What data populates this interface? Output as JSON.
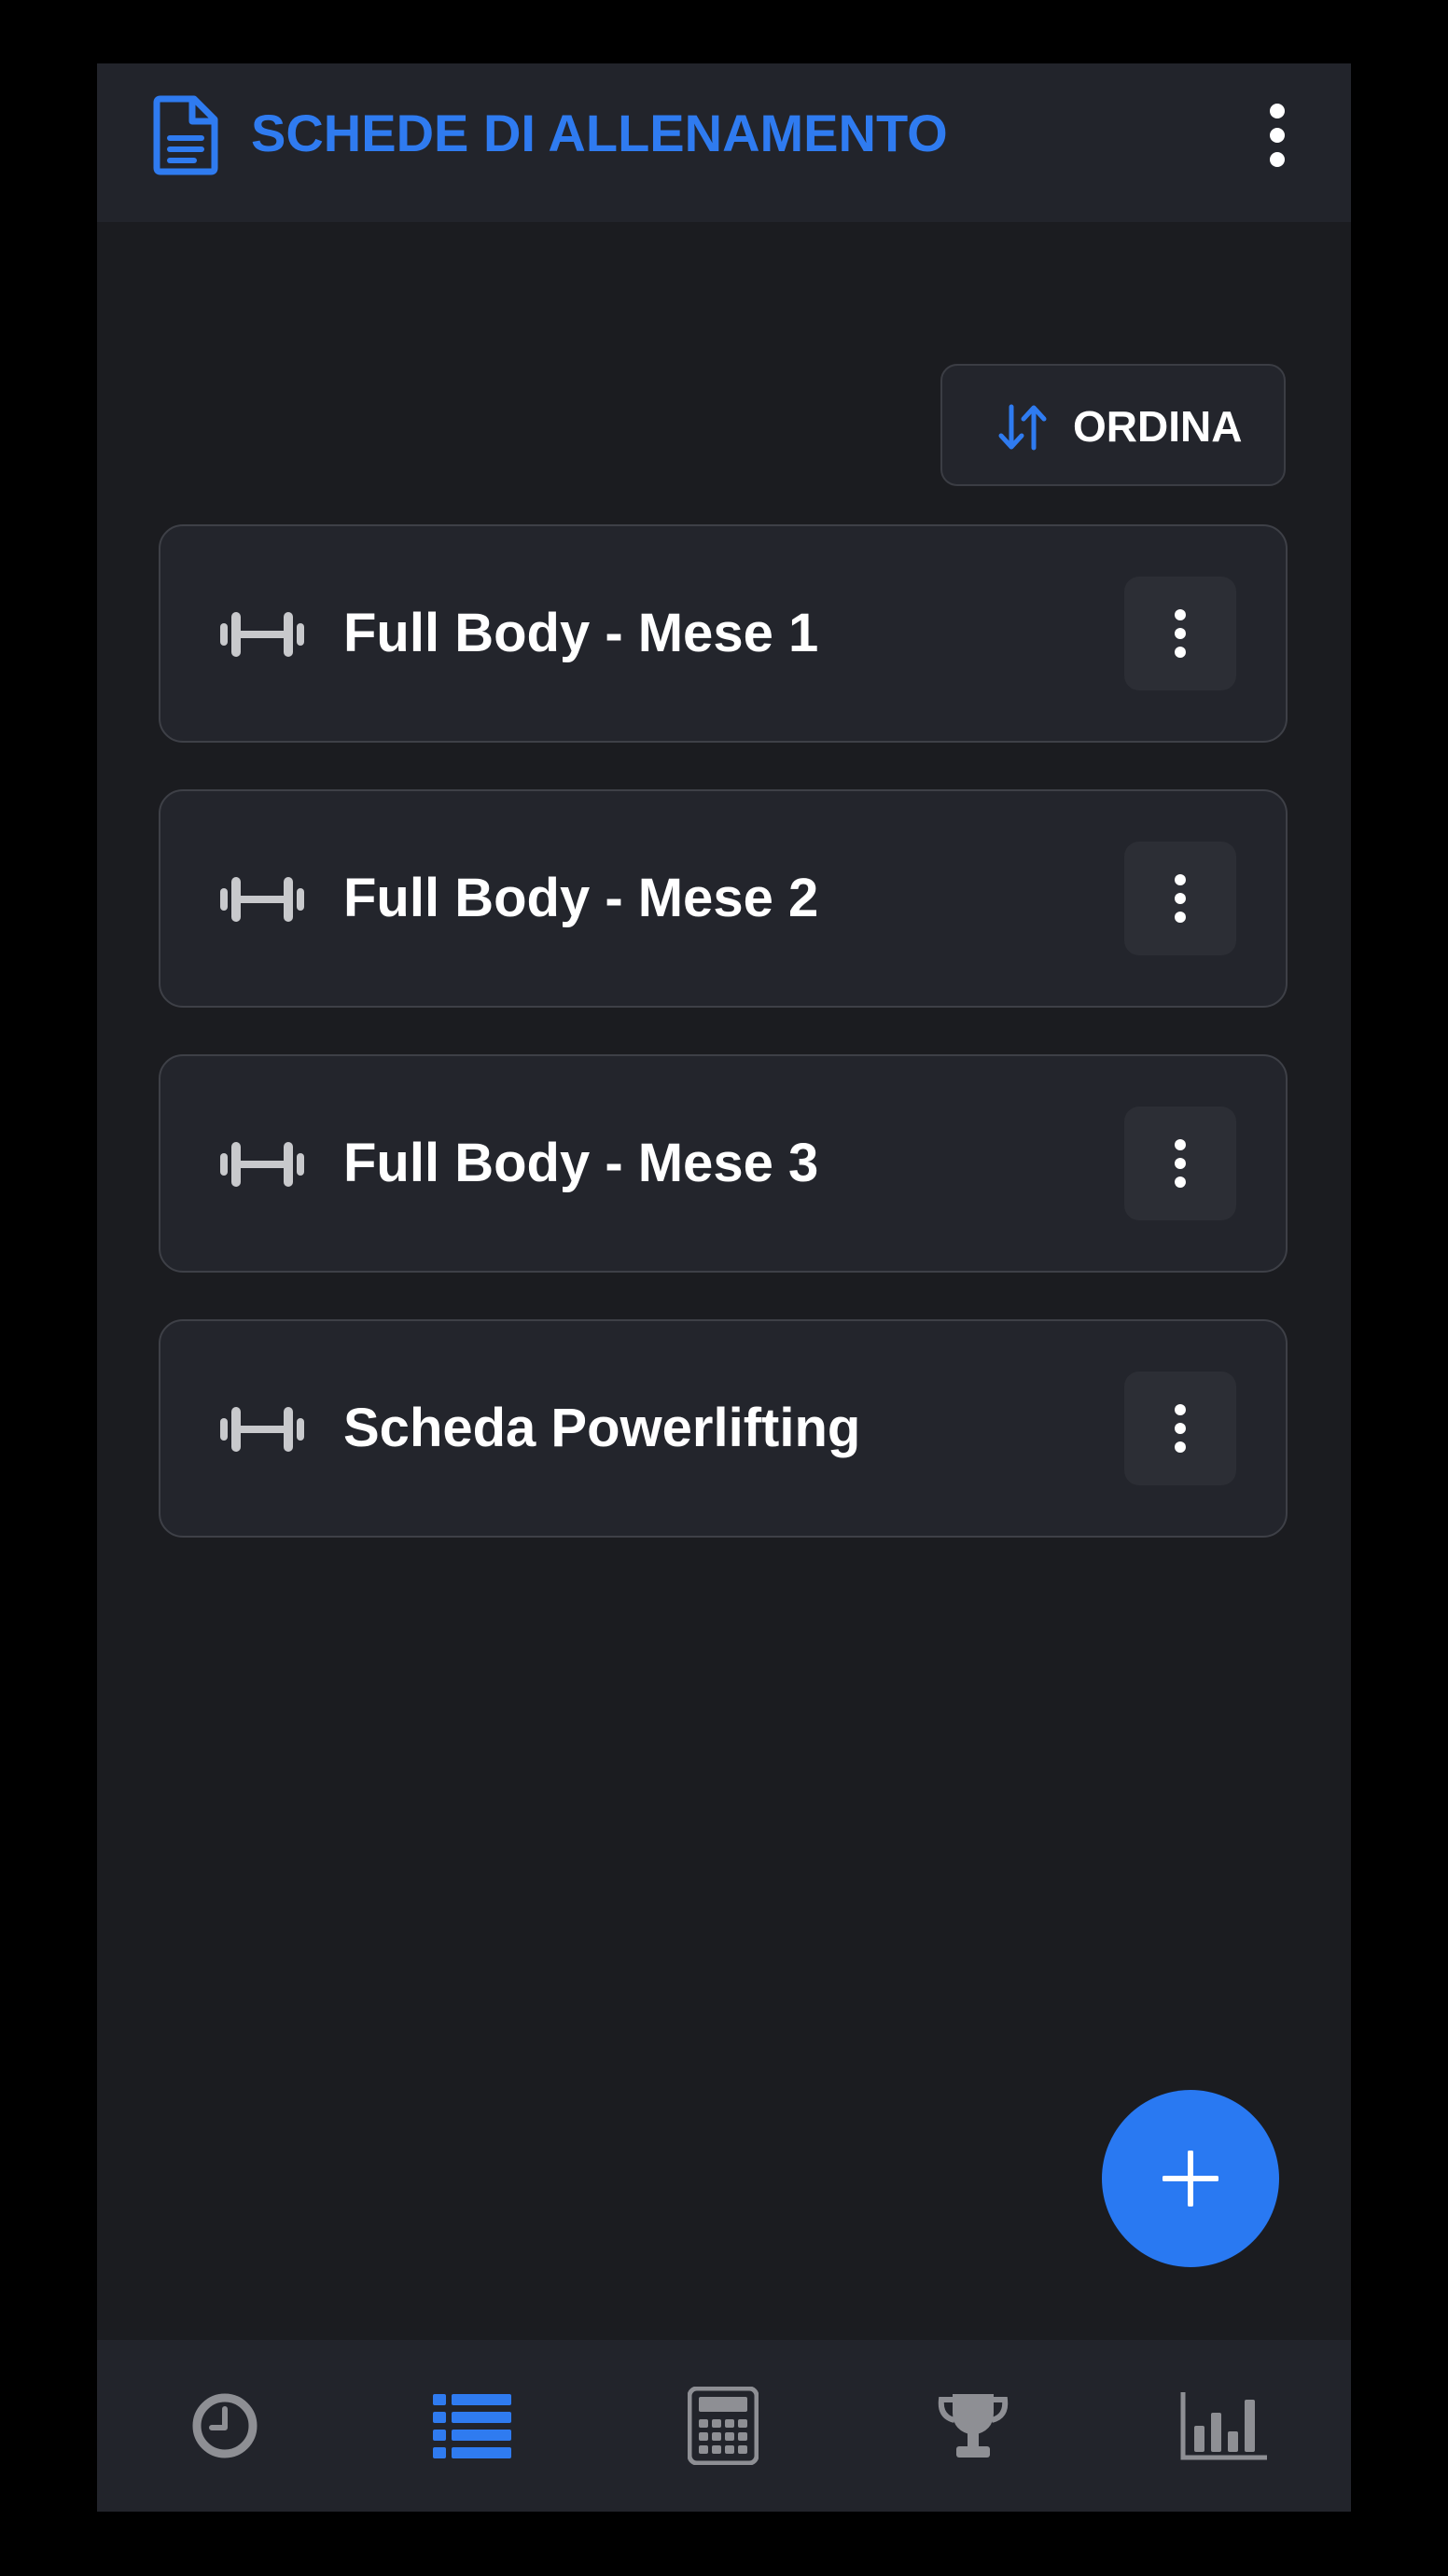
{
  "header": {
    "title": "SCHEDE DI ALLENAMENTO",
    "icon": "document-icon",
    "menu_icon": "more-vertical-icon"
  },
  "toolbar": {
    "sort_label": "ORDINA",
    "sort_icon": "sort-arrows-icon"
  },
  "workouts": [
    {
      "title": "Full Body - Mese 1",
      "icon": "dumbbell-icon",
      "menu_icon": "more-vertical-icon"
    },
    {
      "title": "Full Body - Mese 2",
      "icon": "dumbbell-icon",
      "menu_icon": "more-vertical-icon"
    },
    {
      "title": "Full Body - Mese 3",
      "icon": "dumbbell-icon",
      "menu_icon": "more-vertical-icon"
    },
    {
      "title": "Scheda Powerlifting",
      "icon": "dumbbell-icon",
      "menu_icon": "more-vertical-icon"
    }
  ],
  "fab": {
    "icon": "plus-icon"
  },
  "bottom_nav": [
    {
      "id": "history",
      "icon": "clock-icon",
      "active": false
    },
    {
      "id": "workouts",
      "icon": "list-icon",
      "active": true
    },
    {
      "id": "calculator",
      "icon": "calculator-icon",
      "active": false
    },
    {
      "id": "records",
      "icon": "trophy-icon",
      "active": false
    },
    {
      "id": "stats",
      "icon": "bar-chart-icon",
      "active": false
    }
  ],
  "colors": {
    "accent": "#2f7bf0",
    "background": "#1b1c20",
    "surface": "#23252c",
    "text": "#ffffff",
    "icon_inactive": "#8e8f94"
  }
}
